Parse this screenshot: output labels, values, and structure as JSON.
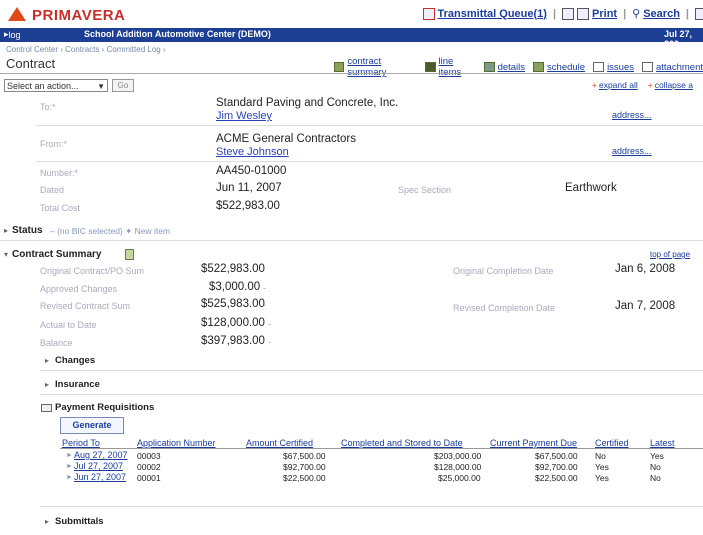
{
  "app": {
    "logo": "PRIMAVERA"
  },
  "toolbar": {
    "transmittal": "Transmittal Queue(1)",
    "print": "Print",
    "search": "Search"
  },
  "bluebar": {
    "logout": "log out",
    "project": "School Addition Automotive Center (DEMO)",
    "date": "Jul 27, 200"
  },
  "breadcrumb": "Control Center › Contracts › Committed Log ›",
  "page": {
    "title": "Contract"
  },
  "tabs": [
    {
      "label": "contract summary",
      "icon": "summary-icon"
    },
    {
      "label": "line items",
      "icon": "list-icon"
    },
    {
      "label": "details",
      "icon": "details-icon"
    },
    {
      "label": "schedule",
      "icon": "schedule-icon"
    },
    {
      "label": "issues",
      "icon": "issues-icon"
    },
    {
      "label": "attachment",
      "icon": "attachment-icon"
    }
  ],
  "actions": {
    "select": "Select an action...",
    "go": "Go",
    "expand_all": "expand all",
    "collapse_all": "collapse a"
  },
  "header": {
    "to_label": "To:*",
    "to_company": "Standard Paving and Concrete, Inc.",
    "to_contact": "Jim Wesley",
    "from_label": "From:*",
    "from_company": "ACME General Contractors",
    "from_contact": "Steve Johnson",
    "address": "address...",
    "number_label": "Number:*",
    "number": "AA450-01000",
    "dated_label": "Dated",
    "dated": "Jun 11, 2007",
    "spec_label": "Spec Section",
    "spec": "Earthwork",
    "total_label": "Total Cost",
    "total": "$522,983.00"
  },
  "status": {
    "label": "Status",
    "detail": "– (no BIC selected) ✦ New item"
  },
  "summary": {
    "title": "Contract Summary",
    "top_link": "top of page",
    "orig_sum_label": "Original Contract/PO Sum",
    "orig_sum": "$522,983.00",
    "approved_label": "Approved Changes",
    "approved": "$3,000.00",
    "revised_label": "Revised Contract Sum",
    "revised": "$525,983.00",
    "actual_label": "Actual to Date",
    "actual": "$128,000.00",
    "balance_label": "Balance",
    "balance": "$397,983.00",
    "orig_completion_label": "Original Completion Date",
    "orig_completion": "Jan 6, 2008",
    "rev_completion_label": "Revised Completion Date",
    "rev_completion": "Jan 7, 2008"
  },
  "sections": {
    "changes": "Changes",
    "insurance": "Insurance",
    "payment": "Payment Requisitions",
    "submittals": "Submittals"
  },
  "payment": {
    "generate": "Generate",
    "columns": [
      "Period To",
      "Application Number",
      "Amount Certified",
      "Completed and Stored to Date",
      "Current Payment Due",
      "Certified",
      "Latest"
    ],
    "rows": [
      {
        "period": "Aug 27, 2007",
        "app": "00003",
        "amount": "$67,500.00",
        "completed": "$203,000.00",
        "due": "$67,500.00",
        "certified": "No",
        "latest": "Yes"
      },
      {
        "period": "Jul 27, 2007",
        "app": "00002",
        "amount": "$92,700.00",
        "completed": "$128,000.00",
        "due": "$92,700.00",
        "certified": "Yes",
        "latest": "No"
      },
      {
        "period": "Jun 27, 2007",
        "app": "00001",
        "amount": "$22,500.00",
        "completed": "$25,000.00",
        "due": "$22,500.00",
        "certified": "Yes",
        "latest": "No"
      }
    ]
  },
  "colors": {
    "brand": "#c7302a",
    "bar": "#1c3f94",
    "link": "#1a3d9c"
  }
}
